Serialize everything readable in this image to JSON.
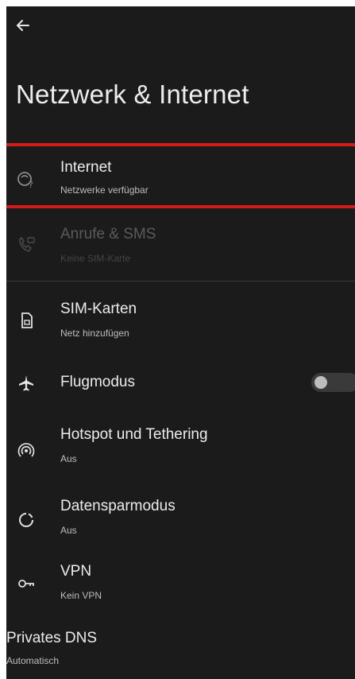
{
  "header": {
    "back_icon": "arrow-left-icon",
    "title": "Netzwerk & Internet"
  },
  "colors": {
    "background": "#1b1b1b",
    "highlight": "#d41a1a",
    "text_primary": "#ececec",
    "text_secondary": "#bdbdbd",
    "text_disabled": "#5a5a5a"
  },
  "items": [
    {
      "label": "Internet",
      "sub": "Netzwerke verfügbar",
      "icon": "wifi-question-icon",
      "enabled": true,
      "highlighted": true
    },
    {
      "label": "Anrufe & SMS",
      "sub": "Keine SIM-Karte",
      "icon": "phone-sms-icon",
      "enabled": false
    },
    {
      "label": "SIM-Karten",
      "sub": "Netz hinzufügen",
      "icon": "sim-card-icon",
      "enabled": true
    },
    {
      "label": "Flugmodus",
      "icon": "airplane-icon",
      "enabled": true,
      "toggle_on": false
    },
    {
      "label": "Hotspot und Tethering",
      "sub": "Aus",
      "icon": "hotspot-icon",
      "enabled": true
    },
    {
      "label": "Datensparmodus",
      "sub": "Aus",
      "icon": "data-saver-icon",
      "enabled": true
    },
    {
      "label": "VPN",
      "sub": "Kein VPN",
      "icon": "vpn-key-icon",
      "enabled": true
    }
  ],
  "private_dns": {
    "label": "Privates DNS",
    "sub": "Automatisch"
  }
}
